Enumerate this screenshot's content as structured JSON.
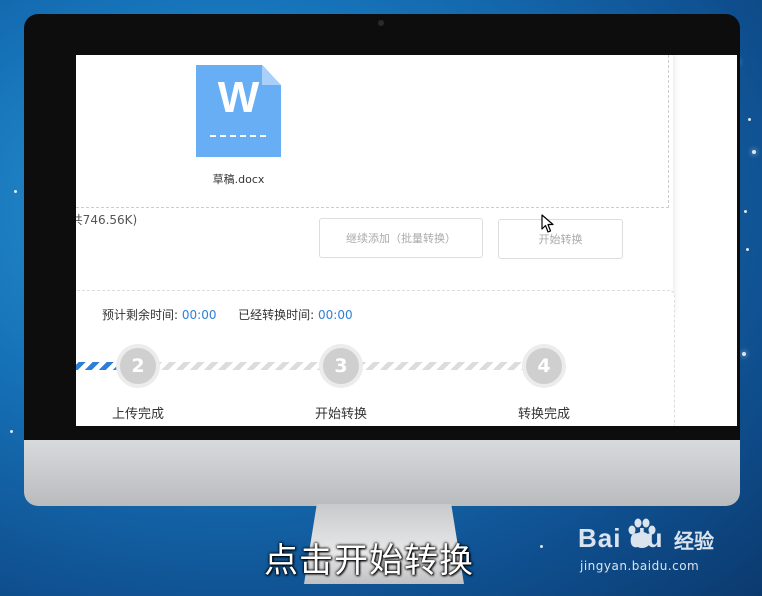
{
  "upload": {
    "file_icon_letter": "W",
    "file_name": "草稿.docx",
    "total_size": "(共746.56K)",
    "add_more_label": "继续添加（批量转换）",
    "start_convert_label": "开始转换"
  },
  "progress": {
    "remaining_label": "预计剩余时间:",
    "remaining_value": "00:00",
    "elapsed_label": "已经转换时间:",
    "elapsed_value": "00:00",
    "steps": [
      {
        "number": "2",
        "label": "上传完成"
      },
      {
        "number": "3",
        "label": "开始转换"
      },
      {
        "number": "4",
        "label": "转换完成"
      }
    ]
  },
  "caption": "点击开始转换",
  "watermark": {
    "logo": "Bai  du",
    "product": "经验",
    "url": "jingyan.baidu.com"
  },
  "colors": {
    "accent": "#2f7fd6",
    "file_icon": "#67aef5",
    "step_inactive": "#cfcfcf"
  }
}
